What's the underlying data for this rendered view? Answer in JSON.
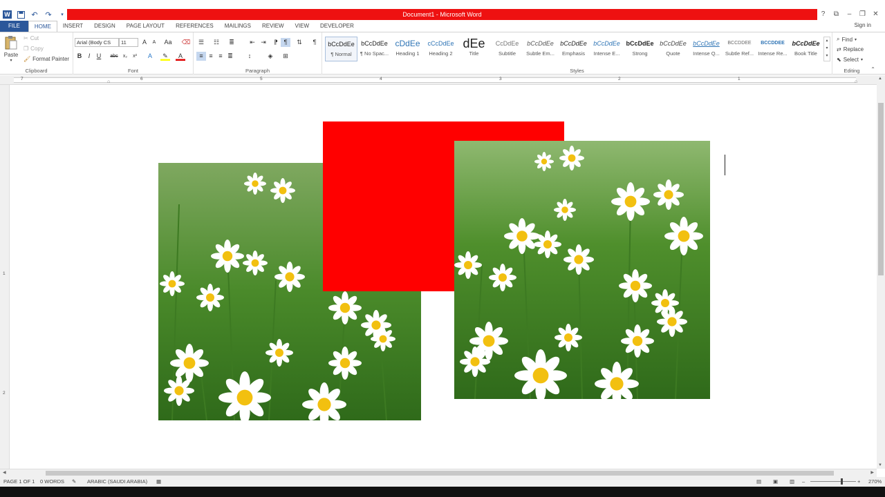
{
  "window": {
    "title": "Document1 - Microsoft Word",
    "accent": "#ee1111",
    "brand": "#2b579a"
  },
  "qat": {
    "icons": [
      "word-icon",
      "save-icon",
      "undo-icon",
      "redo-icon",
      "customize-icon"
    ]
  },
  "controls": {
    "help": "?",
    "ribbon_display": "⧉",
    "minimize": "–",
    "restore": "❐",
    "close": "✕"
  },
  "tabs": [
    "FILE",
    "HOME",
    "INSERT",
    "DESIGN",
    "PAGE LAYOUT",
    "REFERENCES",
    "MAILINGS",
    "REVIEW",
    "VIEW",
    "DEVELOPER"
  ],
  "active_tab": "HOME",
  "signin": "Sign in",
  "clipboard": {
    "paste": "Paste",
    "cut": "Cut",
    "copy": "Copy",
    "format_painter": "Format Painter",
    "label": "Clipboard"
  },
  "font": {
    "name": "Arial (Body CS",
    "size": "11",
    "label": "Font",
    "bold": "B",
    "italic": "I",
    "underline": "U",
    "strike": "abc",
    "sub": "x₂",
    "sup": "x²",
    "grow": "A",
    "shrink": "A",
    "case": "Aa"
  },
  "paragraph": {
    "label": "Paragraph",
    "pilcrow": "¶"
  },
  "styles": {
    "label": "Styles",
    "items": [
      {
        "sample": "bCcDdEe",
        "name": "¶ Normal"
      },
      {
        "sample": "bCcDdEe",
        "name": "¶ No Spac..."
      },
      {
        "sample": "cDdEe",
        "name": "Heading 1"
      },
      {
        "sample": "cCcDdEe",
        "name": "Heading 2"
      },
      {
        "sample": "dEe",
        "name": "Title"
      },
      {
        "sample": "CcDdEe",
        "name": "Subtitle"
      },
      {
        "sample": "bCcDdEe",
        "name": "Subtle Em..."
      },
      {
        "sample": "bCcDdEe",
        "name": "Emphasis"
      },
      {
        "sample": "bCcDdEe",
        "name": "Intense E..."
      },
      {
        "sample": "bCcDdEe",
        "name": "Strong"
      },
      {
        "sample": "bCcDdEe",
        "name": "Quote"
      },
      {
        "sample": "bCcDdEe",
        "name": "Intense Q..."
      },
      {
        "sample": "BCCDDEE",
        "name": "Subtle Ref..."
      },
      {
        "sample": "BCCDDEE",
        "name": "Intense Re..."
      },
      {
        "sample": "bCcDdEe",
        "name": "Book Title"
      }
    ]
  },
  "editing": {
    "label": "Editing",
    "find": "Find",
    "replace": "Replace",
    "select": "Select"
  },
  "ruler": {
    "numbers": [
      "7",
      "6",
      "5",
      "4",
      "3",
      "2",
      "1"
    ],
    "vnumbers": [
      "1",
      "2"
    ]
  },
  "status": {
    "page": "PAGE 1 OF 1",
    "words": "0 WORDS",
    "language": "ARABIC (SAUDI ARABIA)",
    "zoom": "270%"
  },
  "colors": {
    "red_shape": "#ff0000",
    "grass": "#4a8a2a",
    "petal": "#ffffff",
    "center": "#f2c010"
  }
}
